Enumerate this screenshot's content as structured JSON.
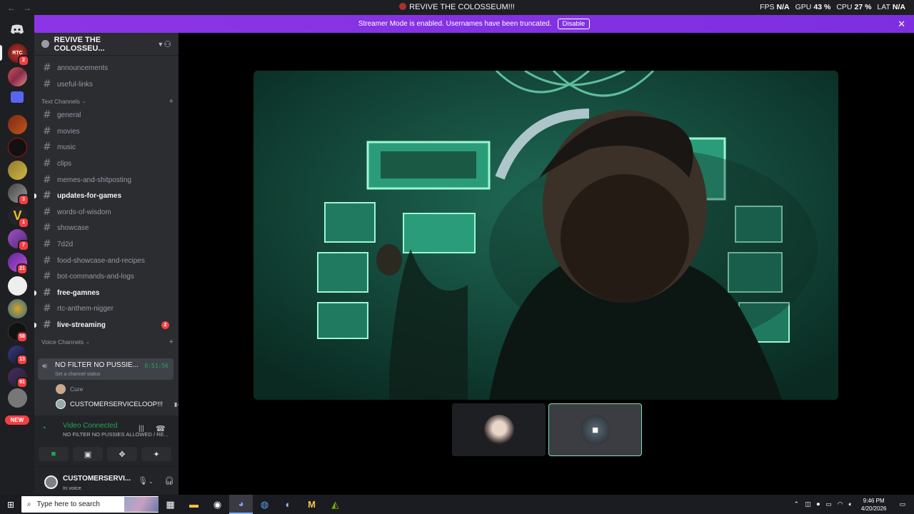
{
  "titlebar": {
    "title": "REVIVE THE COLOSSEUM!!!",
    "nav_back": "←",
    "nav_fwd": "→"
  },
  "overlay": {
    "fps_label": "FPS",
    "fps_value": "N/A",
    "gpu_label": "GPU",
    "gpu_value": "43 %",
    "cpu_label": "CPU",
    "cpu_value": "27 %",
    "lat_label": "LAT",
    "lat_value": "N/A"
  },
  "streamer_bar": {
    "message": "Streamer Mode is enabled. Usernames have been truncated.",
    "disable_label": "Disable",
    "close": "✕"
  },
  "rail": {
    "badges": [
      "2",
      "3",
      "1",
      "7",
      "21",
      "58",
      "13",
      "91"
    ],
    "new_label": "NEW",
    "server_initials": "RTC"
  },
  "server": {
    "name": "REVIVE THE COLOSSEU...",
    "chevron": "⌄"
  },
  "channels": {
    "top": [
      {
        "name": "announcements"
      },
      {
        "name": "useful-links"
      }
    ],
    "text_category": "Text Channels",
    "text": [
      {
        "name": "general"
      },
      {
        "name": "movies"
      },
      {
        "name": "music"
      },
      {
        "name": "clips"
      },
      {
        "name": "memes-and-shitposting"
      },
      {
        "name": "updates-for-games"
      },
      {
        "name": "words-of-wisdom"
      },
      {
        "name": "showcase"
      },
      {
        "name": "7d2d"
      },
      {
        "name": "food-showcase-and-recipes"
      },
      {
        "name": "bot-commands-and-logs"
      },
      {
        "name": "free-gamnes"
      },
      {
        "name": "rtc-anthem-nigger"
      },
      {
        "name": "live-streaming",
        "mentions": "2"
      }
    ],
    "voice_category": "Voice Channels",
    "voice": {
      "name": "NO FILTER NO PUSSIE...",
      "status": "Set a channel status",
      "timer": "8:51:56",
      "users": [
        "Cure",
        "CUSTOMERSERVICELOOP!!!"
      ]
    },
    "hash": "#",
    "plus": "+"
  },
  "rtc": {
    "title": "Video Connected",
    "subtitle": "NO FILTER NO PUSSIES ALLOWED / RE..."
  },
  "user": {
    "name": "CUSTOMERSERVI...",
    "status": "In voice"
  },
  "taskbar": {
    "search_placeholder": "Type here to search",
    "time": "9:46 PM",
    "date": "4/20/2026"
  },
  "colors": {
    "streamer_bar": "#8c35e6",
    "voice_green": "#23a559",
    "mention_red": "#f23f43"
  }
}
